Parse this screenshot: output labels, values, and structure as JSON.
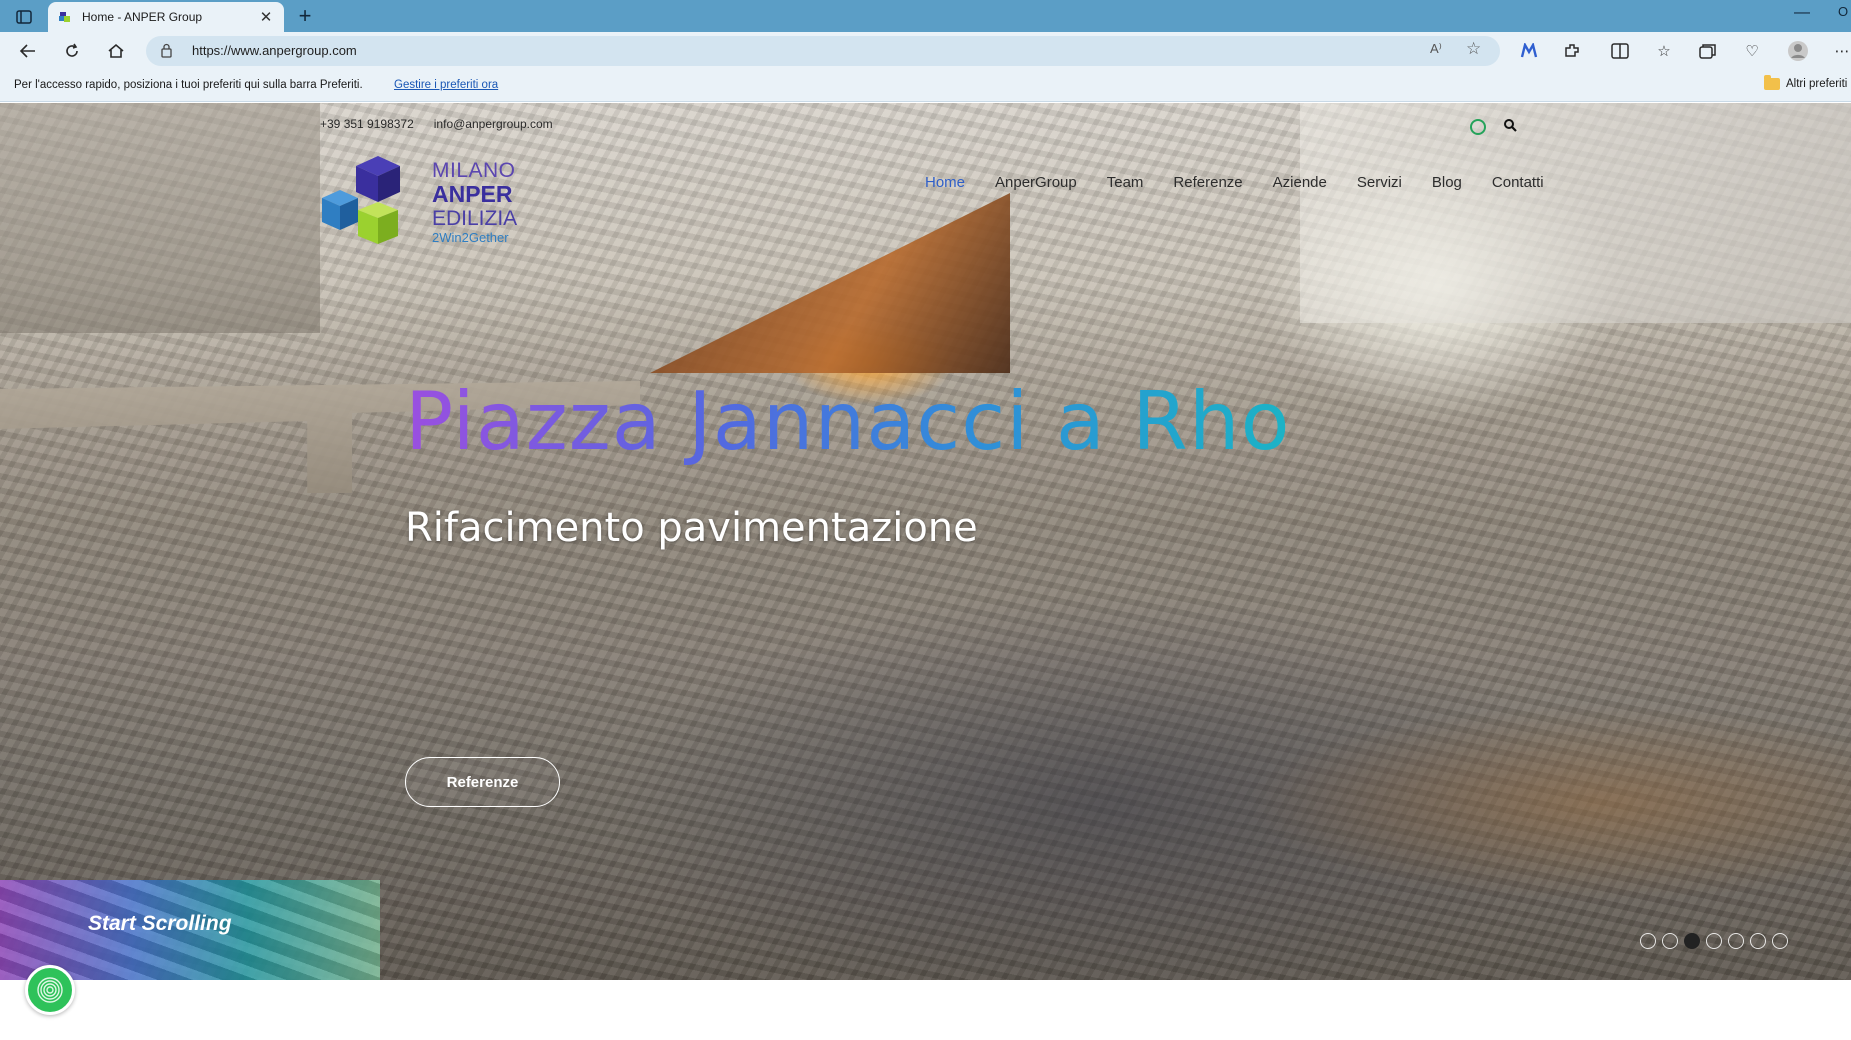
{
  "browser": {
    "tab_title": "Home - ANPER Group",
    "tab_close": "✕",
    "new_tab": "+",
    "url": "https://www.anpergroup.com",
    "read_aloud": "A⁾",
    "window_minimize": "—",
    "window_cut_label": "O"
  },
  "favorites_bar": {
    "message": "Per l'accesso rapido, posiziona i tuoi preferiti qui sulla barra Preferiti.",
    "manage_link": "Gestire i preferiti ora",
    "other_favorites": "Altri preferiti"
  },
  "site": {
    "topbar": {
      "phone": "+39 351 9198372",
      "email": "info@anpergroup.com"
    },
    "logo": {
      "line1": "MILANO",
      "line2": "ANPER",
      "line3": "EDILIZIA",
      "tagline": "2Win2Gether",
      "colors": [
        "#3a2f9e",
        "#2f7ec2",
        "#9bd12f"
      ]
    },
    "nav": {
      "items": [
        "Home",
        "AnperGroup",
        "Team",
        "Referenze",
        "Aziende",
        "Servizi",
        "Blog",
        "Contatti"
      ],
      "active": "Home",
      "active_color": "#2f5fc8"
    },
    "hero": {
      "headline": "Piazza Jannacci a Rho",
      "subline": "Rifacimento pavimentazione",
      "button": "Referenze",
      "scroll_label": "Start Scrolling",
      "slider": {
        "total": 7,
        "active_index": 2
      }
    }
  }
}
